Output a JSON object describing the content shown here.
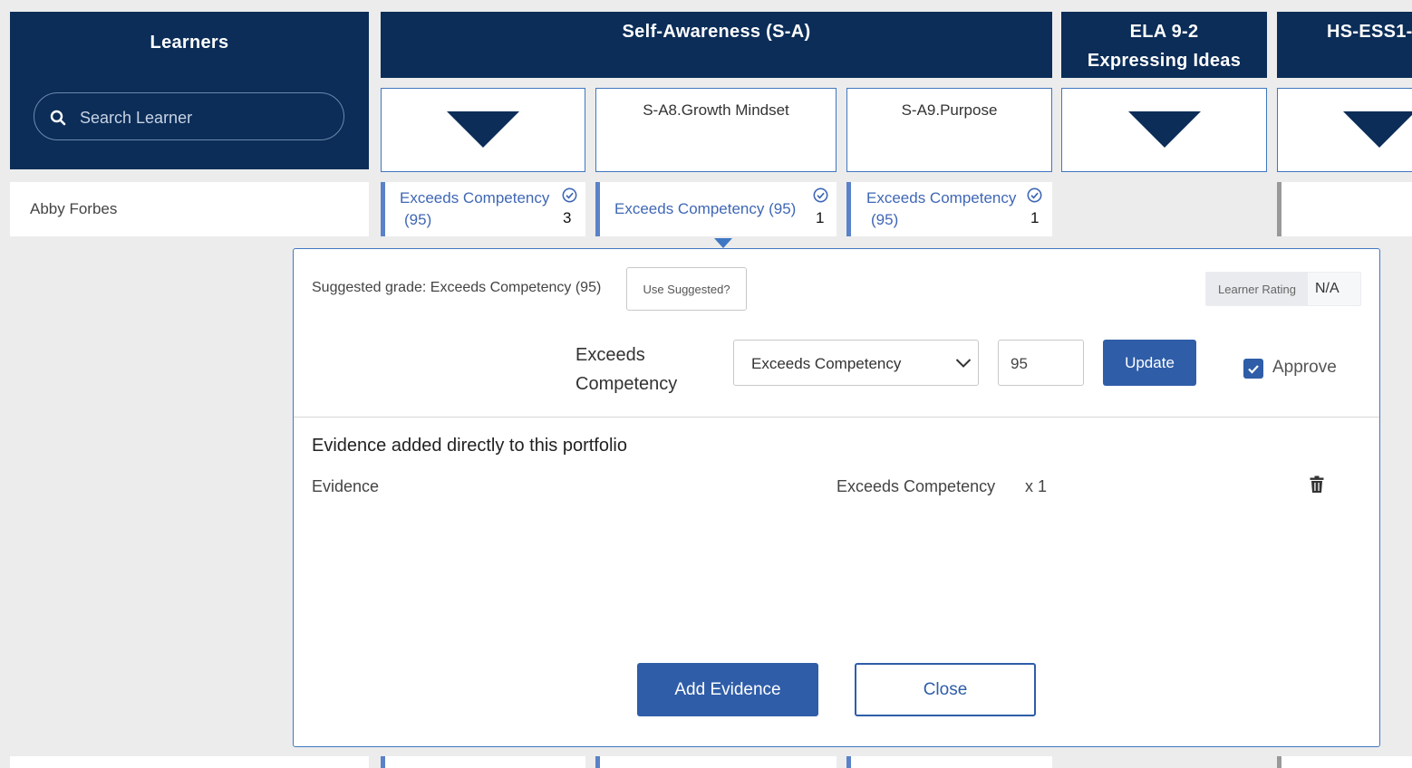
{
  "header": {
    "learners": "Learners",
    "self_awareness": "Self-Awareness (S-A)",
    "ela_line1": "ELA 9-2",
    "ela_line2": "Expressing Ideas",
    "hs": "HS-ESS1-"
  },
  "search": {
    "placeholder": "Search Learner"
  },
  "subcols": {
    "growth": "S-A8.Growth Mindset",
    "purpose": "S-A9.Purpose"
  },
  "learner": {
    "name": "Abby Forbes",
    "cells": [
      {
        "grade_line1": "Exceeds Competency",
        "grade_line2": "(95)",
        "count": "3"
      },
      {
        "grade_line1": "Exceeds Competency (95)",
        "grade_line2": "",
        "count": "1"
      },
      {
        "grade_line1": "Exceeds Competency",
        "grade_line2": "(95)",
        "count": "1"
      }
    ]
  },
  "panel": {
    "suggested": "Suggested grade: Exceeds Competency (95)",
    "use_suggested": "Use Suggested?",
    "learner_rating_label": "Learner Rating",
    "learner_rating_value": "N/A",
    "level_line1": "Exceeds",
    "level_line2": "Competency",
    "select_value": "Exceeds Competency",
    "score": "95",
    "update": "Update",
    "approve": "Approve",
    "approve_checked": true,
    "evidence_title": "Evidence added directly to this portfolio",
    "evidence_rows": [
      {
        "name": "Evidence",
        "grade": "Exceeds Competency",
        "count": "x 1"
      }
    ],
    "add_evidence": "Add Evidence",
    "close": "Close"
  },
  "colors": {
    "navy": "#0b2d58",
    "accent_blue": "#2f5da8",
    "cell_text": "#3f67b5",
    "background": "#ececec"
  }
}
